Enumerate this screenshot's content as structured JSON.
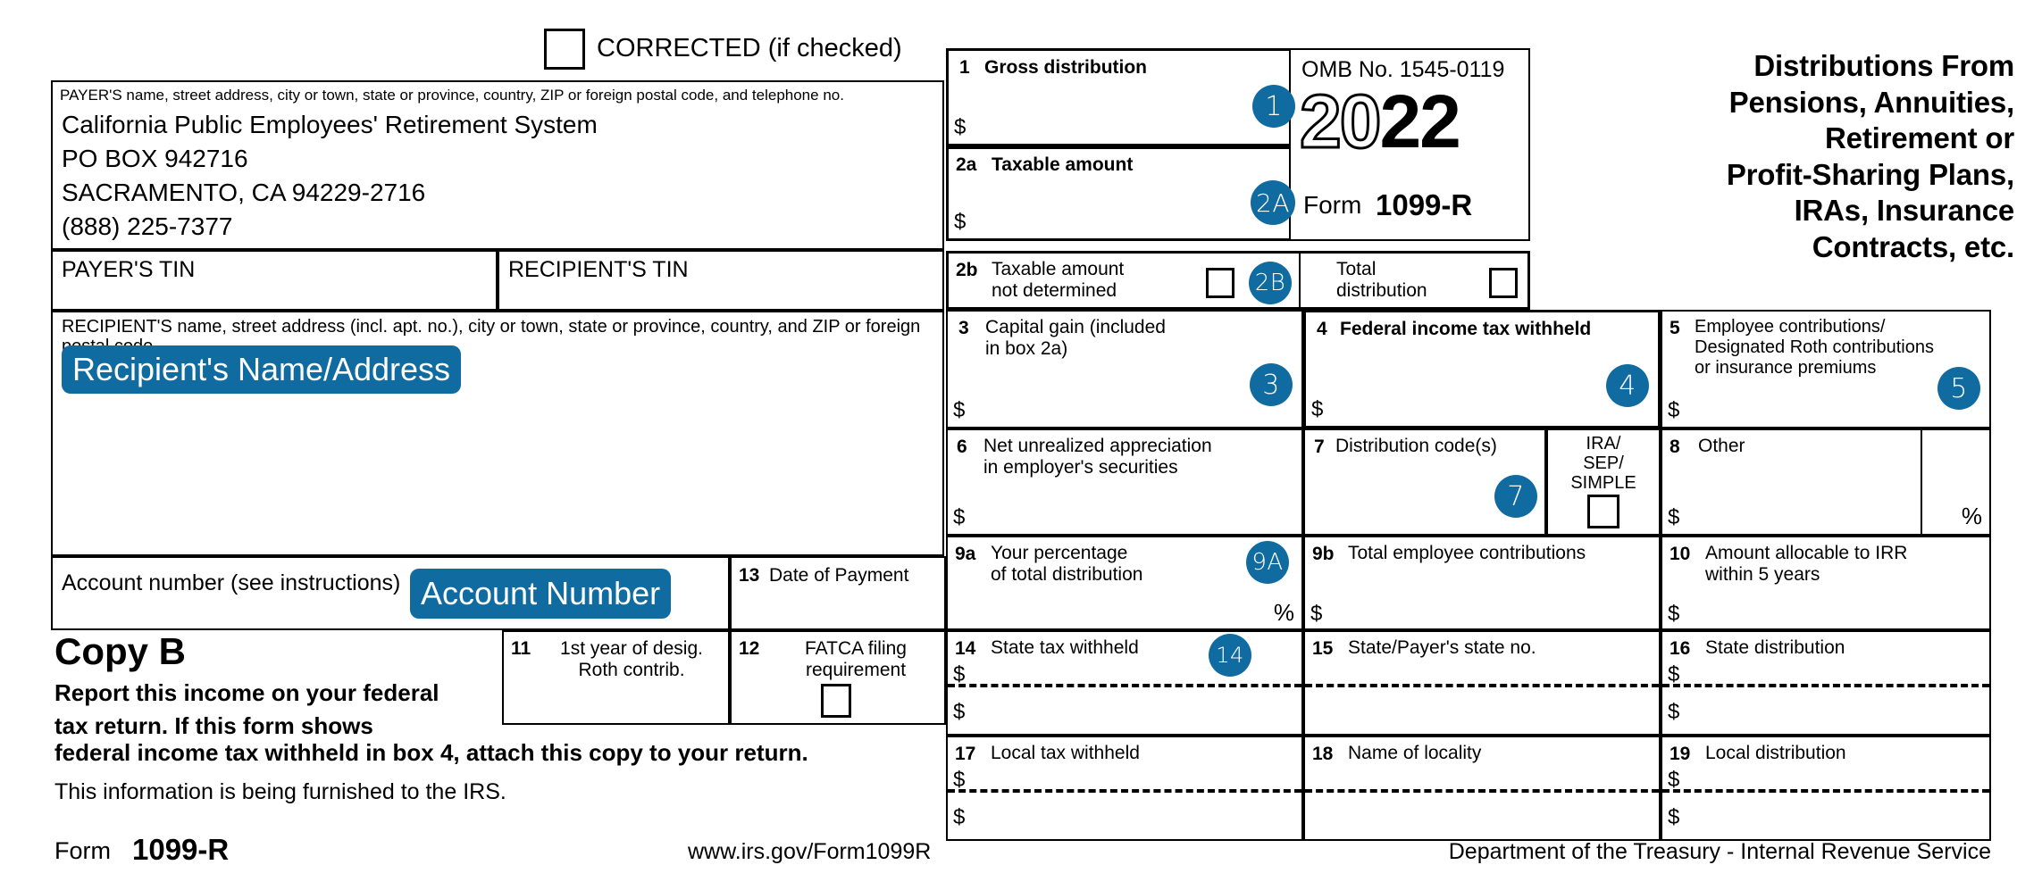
{
  "form": {
    "corrected_label": "CORRECTED (if checked)",
    "title_lines": [
      "Distributions From",
      "Pensions, Annuities,",
      "Retirement or",
      "Profit-Sharing Plans,",
      "IRAs, Insurance",
      "Contracts, etc."
    ],
    "omb": "OMB No. 1545-0119",
    "year_hollow": "20",
    "year_solid": "22",
    "form_word": "Form",
    "form_number": "1099-R",
    "accent_color": "#106BA0"
  },
  "payer": {
    "caption": "PAYER'S name, street address, city or town, state or province, country, ZIP or foreign postal code, and telephone no.",
    "lines": [
      "California Public Employees' Retirement System",
      "PO BOX 942716",
      "SACRAMENTO, CA 94229-2716",
      "(888) 225-7377"
    ]
  },
  "tins": {
    "payer_tin_label": "PAYER'S TIN",
    "recipient_tin_label": "RECIPIENT'S TIN"
  },
  "recipient": {
    "caption": "RECIPIENT'S name, street address (incl. apt. no.), city or town, state or province, country, and ZIP or foreign postal code",
    "chip": "Recipient's Name/Address"
  },
  "account": {
    "caption": "Account number (see instructions)",
    "chip": "Account Number"
  },
  "copy": {
    "heading": "Copy B",
    "bold_lines": [
      "Report this income on your federal",
      "tax return. If this form shows",
      "federal income tax withheld in box 4, attach this copy to your return."
    ],
    "note": "This information is being furnished to the IRS.",
    "footer_form_word": "Form",
    "footer_form_number": "1099-R",
    "url": "www.irs.gov/Form1099R",
    "agency": "Department of the Treasury - Internal Revenue Service"
  },
  "boxes": {
    "b1": {
      "num": "1",
      "cap": "Gross distribution",
      "badge": "1",
      "dollar": "$"
    },
    "b2a": {
      "num": "2a",
      "cap": "Taxable amount",
      "badge": "2A",
      "dollar": "$"
    },
    "b2b": {
      "num": "2b",
      "cap_line1": "Taxable amount",
      "cap_line2": "not determined",
      "badge": "2B"
    },
    "total_dist": {
      "cap_line1": "Total",
      "cap_line2": "distribution"
    },
    "b3": {
      "num": "3",
      "cap_line1": "Capital gain (included",
      "cap_line2": "in box 2a)",
      "badge": "3",
      "dollar": "$"
    },
    "b4": {
      "num": "4",
      "cap": "Federal income tax withheld",
      "badge": "4",
      "dollar": "$"
    },
    "b5": {
      "num": "5",
      "cap_line1": "Employee contributions/",
      "cap_line2": "Designated Roth contributions",
      "cap_line3": "or insurance premiums",
      "badge": "5",
      "dollar": "$"
    },
    "b6": {
      "num": "6",
      "cap_line1": "Net unrealized appreciation",
      "cap_line2": "in employer's securities",
      "dollar": "$"
    },
    "b7": {
      "num": "7",
      "cap": "Distribution code(s)",
      "badge": "7"
    },
    "ira": {
      "l1": "IRA/",
      "l2": "SEP/",
      "l3": "SIMPLE"
    },
    "b8": {
      "num": "8",
      "cap": "Other",
      "dollar": "$",
      "pct": "%"
    },
    "b9a": {
      "num": "9a",
      "cap_line1": "Your percentage",
      "cap_line2": "of total distribution",
      "badge": "9A",
      "pct": "%"
    },
    "b9b": {
      "num": "9b",
      "cap": "Total employee contributions",
      "dollar": "$"
    },
    "b10": {
      "num": "10",
      "cap_line1": "Amount allocable to IRR",
      "cap_line2": "within 5 years",
      "dollar": "$"
    },
    "b11": {
      "num": "11",
      "cap_line1": "1st year of desig.",
      "cap_line2": "Roth contrib."
    },
    "b12": {
      "num": "12",
      "cap_line1": "FATCA filing",
      "cap_line2": "requirement"
    },
    "b13": {
      "num": "13",
      "cap": "Date of Payment"
    },
    "b14": {
      "num": "14",
      "cap": "State tax withheld",
      "badge": "14",
      "dollar1": "$",
      "dollar2": "$"
    },
    "b15": {
      "num": "15",
      "cap": "State/Payer's state no."
    },
    "b16": {
      "num": "16",
      "cap": "State distribution",
      "dollar1": "$",
      "dollar2": "$"
    },
    "b17": {
      "num": "17",
      "cap": "Local tax withheld",
      "dollar1": "$",
      "dollar2": "$"
    },
    "b18": {
      "num": "18",
      "cap": "Name of locality"
    },
    "b19": {
      "num": "19",
      "cap": "Local distribution",
      "dollar1": "$",
      "dollar2": "$"
    }
  }
}
